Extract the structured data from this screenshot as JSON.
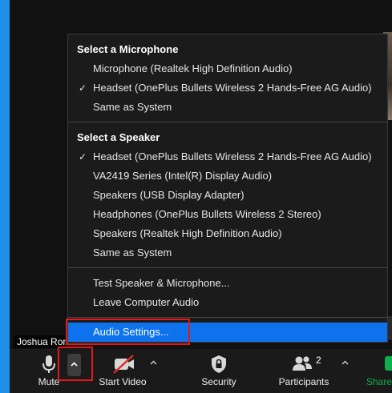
{
  "menu": {
    "microphone_heading": "Select a Microphone",
    "microphones": [
      {
        "label": "Microphone (Realtek High Definition Audio)",
        "checked": false
      },
      {
        "label": "Headset (OnePlus Bullets Wireless 2 Hands-Free AG Audio)",
        "checked": true
      },
      {
        "label": "Same as System",
        "checked": false
      }
    ],
    "speaker_heading": "Select a Speaker",
    "speakers": [
      {
        "label": "Headset (OnePlus Bullets Wireless 2 Hands-Free AG Audio)",
        "checked": true
      },
      {
        "label": "VA2419 Series (Intel(R) Display Audio)",
        "checked": false
      },
      {
        "label": "Speakers (USB Display Adapter)",
        "checked": false
      },
      {
        "label": "Headphones (OnePlus Bullets Wireless 2 Stereo)",
        "checked": false
      },
      {
        "label": "Speakers (Realtek High Definition Audio)",
        "checked": false
      },
      {
        "label": "Same as System",
        "checked": false
      }
    ],
    "test_label": "Test Speaker & Microphone...",
    "leave_label": "Leave Computer Audio",
    "settings_label": "Audio Settings...",
    "check_glyph": "✓"
  },
  "participant_name": "Joshua Ron",
  "toolbar": {
    "mute_label": "Mute",
    "start_video_label": "Start Video",
    "security_label": "Security",
    "participants_label": "Participants",
    "participants_count": "2",
    "share_label": "Share"
  },
  "colors": {
    "highlight": "#0e72ed",
    "annotation": "#e1191c",
    "share_green": "#0db14b"
  }
}
